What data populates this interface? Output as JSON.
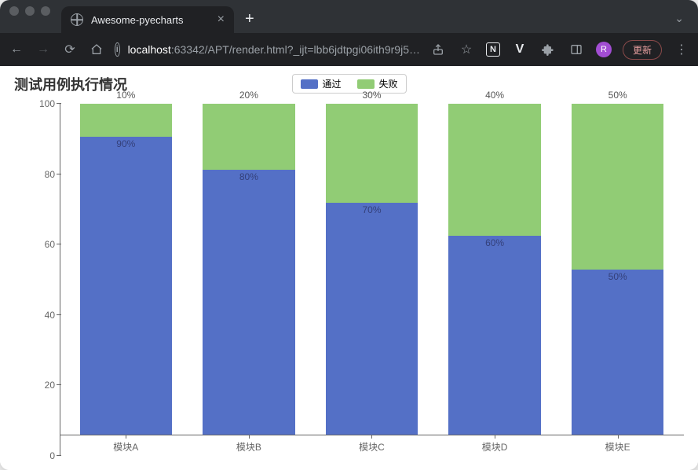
{
  "window": {
    "tab_title": "Awesome-pyecharts",
    "new_tab_glyph": "+",
    "close_glyph": "×",
    "minimize_glyph": "⌄"
  },
  "toolbar": {
    "back_glyph": "←",
    "forward_glyph": "→",
    "reload_glyph": "⟳",
    "home_glyph": "⌂",
    "info_glyph": "i",
    "url_host": "localhost",
    "url_rest": ":63342/APT/render.html?_ijt=lbb6jdtpgi06ith9r9j5…",
    "share_glyph": "⇪",
    "star_glyph": "☆",
    "notion_glyph": "N",
    "v_glyph": "V",
    "ext_glyph": "✦",
    "window_glyph": "▣",
    "avatar_glyph": "R",
    "update_label": "更新",
    "menu_glyph": "⋮"
  },
  "chart_ui": {
    "title": "测试用例执行情况",
    "legend": {
      "pass": "通过",
      "fail": "失败"
    },
    "colors": {
      "pass": "#5470c6",
      "fail": "#91cc75"
    }
  },
  "chart_data": {
    "type": "bar",
    "stacked": true,
    "title": "测试用例执行情况",
    "xlabel": "",
    "ylabel": "",
    "ylim": [
      0,
      100
    ],
    "y_ticks": [
      0,
      20,
      40,
      60,
      80,
      100
    ],
    "categories": [
      "模块A",
      "模块B",
      "模块C",
      "模块D",
      "模块E"
    ],
    "series": [
      {
        "name": "通过",
        "values": [
          90,
          80,
          70,
          60,
          50
        ],
        "labels": [
          "90%",
          "80%",
          "70%",
          "60%",
          "50%"
        ],
        "color": "#5470c6"
      },
      {
        "name": "失败",
        "values": [
          10,
          20,
          30,
          40,
          50
        ],
        "labels": [
          "10%",
          "20%",
          "30%",
          "40%",
          "50%"
        ],
        "color": "#91cc75"
      }
    ]
  }
}
